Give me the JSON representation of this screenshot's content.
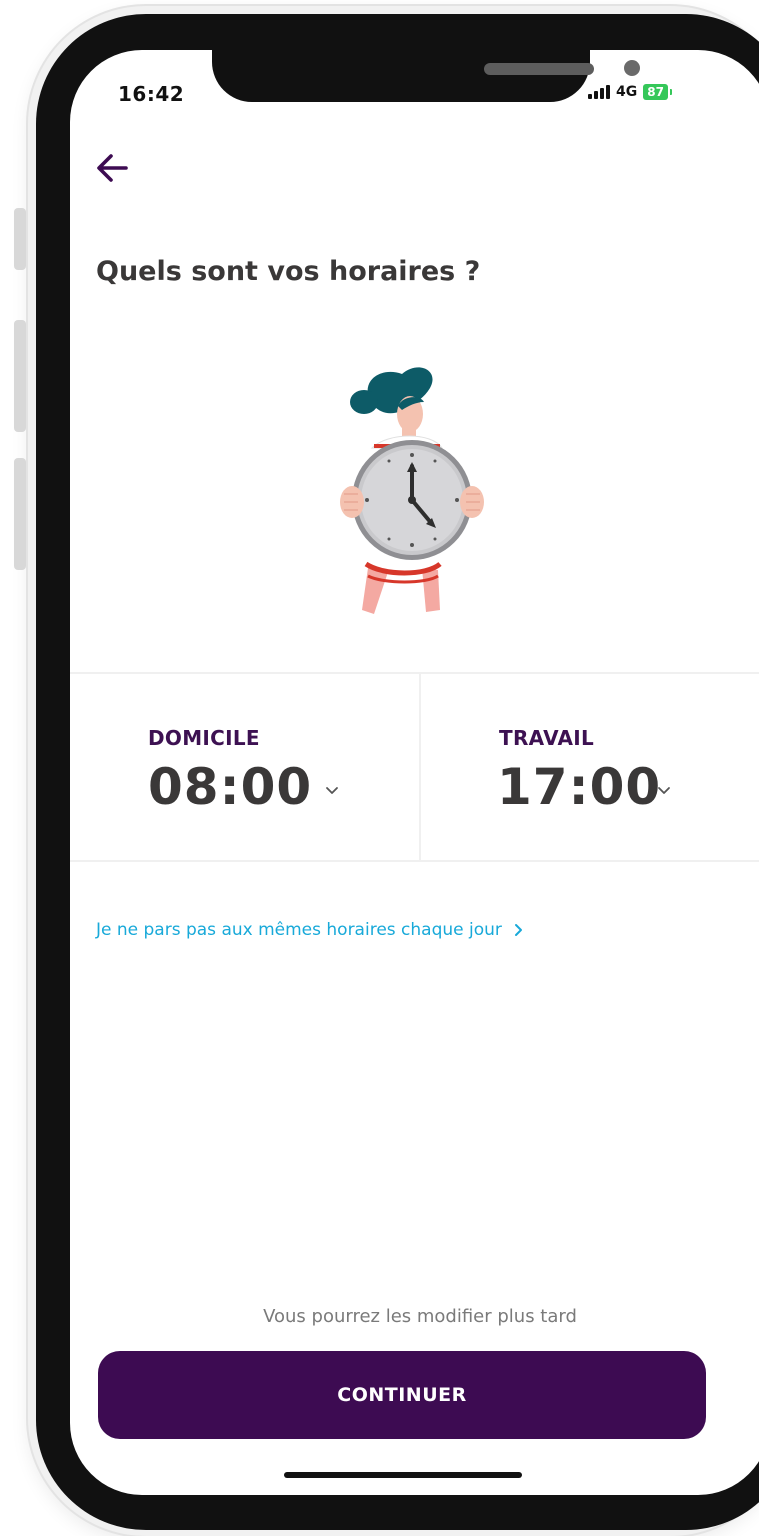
{
  "status_bar": {
    "time": "16:42",
    "network": "4G",
    "battery": "87"
  },
  "header": {
    "back_icon": "arrow-left-icon",
    "title": "Quels sont vos horaires ?"
  },
  "illustration": {
    "icon": "woman-holding-clock-illustration"
  },
  "schedule": {
    "home": {
      "label": "DOMICILE",
      "time": "08:00",
      "icon": "chevron-down-icon"
    },
    "work": {
      "label": "TRAVAIL",
      "time": "17:00",
      "icon": "chevron-down-icon"
    }
  },
  "varying_link": {
    "label": "Je ne pars pas aux mêmes horaires chaque jour",
    "icon": "chevron-right-icon"
  },
  "footer": {
    "hint": "Vous pourrez les modifier plus tard",
    "continue_label": "CONTINUER"
  },
  "colors": {
    "primary": "#3d0b52",
    "link": "#18a9d9",
    "text": "#3a3838",
    "label": "#3d1152"
  }
}
